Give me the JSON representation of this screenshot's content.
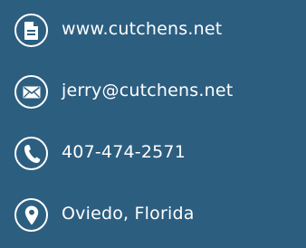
{
  "contacts": [
    {
      "type": "website",
      "icon": "document-icon",
      "text": "www.cutchens.net"
    },
    {
      "type": "email",
      "icon": "envelope-icon",
      "text": "jerry@cutchens.net"
    },
    {
      "type": "phone",
      "icon": "phone-icon",
      "text": "407-474-2571"
    },
    {
      "type": "location",
      "icon": "map-pin-icon",
      "text": "Oviedo, Florida"
    }
  ],
  "colors": {
    "background": "#2c5e80",
    "foreground": "#ffffff"
  }
}
